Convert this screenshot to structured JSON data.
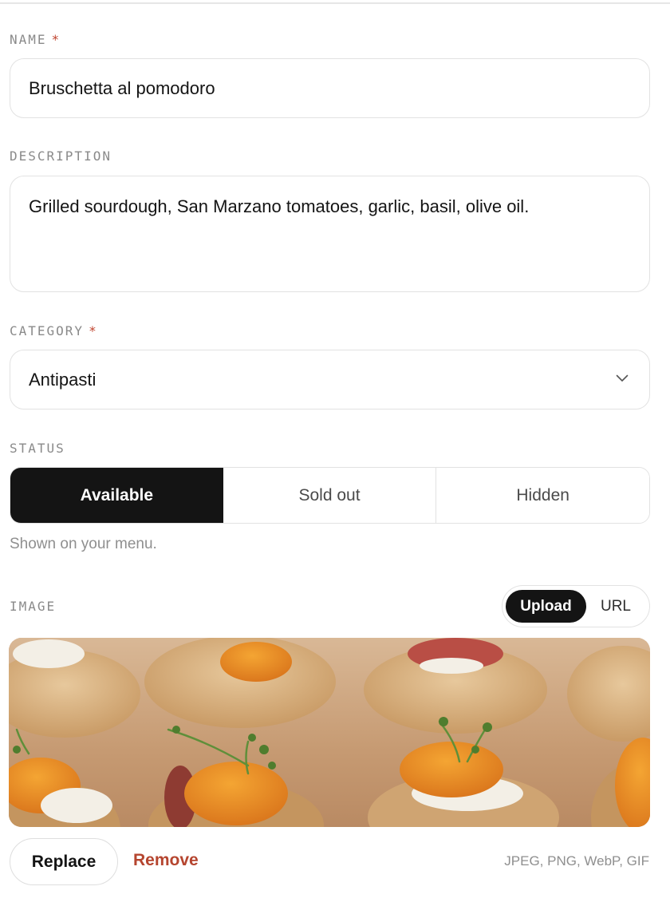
{
  "name_field": {
    "label": "NAME",
    "required_mark": "*",
    "value": "Bruschetta al pomodoro"
  },
  "description_field": {
    "label": "DESCRIPTION",
    "value": "Grilled sourdough, San Marzano tomatoes, garlic, basil, olive oil."
  },
  "category_field": {
    "label": "CATEGORY",
    "required_mark": "*",
    "selected": "Antipasti",
    "icon": "chevron-down-icon"
  },
  "status_field": {
    "label": "STATUS",
    "options": [
      "Available",
      "Sold out",
      "Hidden"
    ],
    "selected": "Available",
    "help": "Shown on your menu."
  },
  "image_field": {
    "label": "IMAGE",
    "source_toggle": [
      "Upload",
      "URL"
    ],
    "selected_source": "Upload",
    "replace_label": "Replace",
    "remove_label": "Remove",
    "formats": "JPEG, PNG, WebP, GIF"
  },
  "colors": {
    "accent_dark": "#141414",
    "required": "#c0452f",
    "remove": "#b5452f",
    "border": "#e2e2e2",
    "muted_text": "#8a8a8a"
  }
}
